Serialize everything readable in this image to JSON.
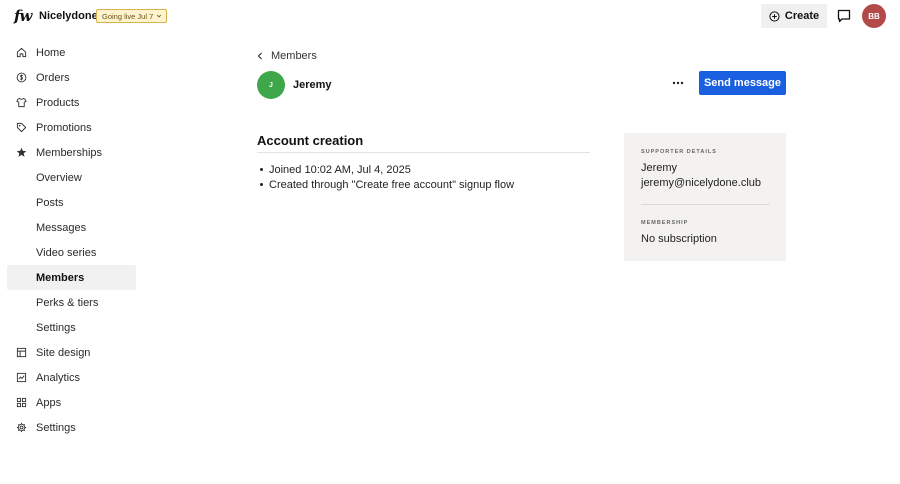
{
  "header": {
    "logo_text": "fw",
    "site_name": "Nicelydone",
    "live_badge": "Going live Jul 7",
    "create_label": "Create",
    "user_initials": "BB"
  },
  "sidebar": {
    "items": [
      {
        "label": "Home",
        "icon": "home-icon"
      },
      {
        "label": "Orders",
        "icon": "orders-icon"
      },
      {
        "label": "Products",
        "icon": "products-icon"
      },
      {
        "label": "Promotions",
        "icon": "tag-icon"
      },
      {
        "label": "Memberships",
        "icon": "star-icon"
      },
      {
        "label": "Overview"
      },
      {
        "label": "Posts"
      },
      {
        "label": "Messages"
      },
      {
        "label": "Video series"
      },
      {
        "label": "Members",
        "active": true
      },
      {
        "label": "Perks & tiers"
      },
      {
        "label": "Settings"
      },
      {
        "label": "Site design",
        "icon": "layout-icon"
      },
      {
        "label": "Analytics",
        "icon": "analytics-icon"
      },
      {
        "label": "Apps",
        "icon": "apps-icon"
      },
      {
        "label": "Settings",
        "icon": "gear-icon"
      }
    ]
  },
  "main": {
    "breadcrumb": "Members",
    "member": {
      "initial": "J",
      "name": "Jeremy"
    },
    "send_message_label": "Send message",
    "section_title": "Account creation",
    "events": [
      "Joined 10:02 AM, Jul 4, 2025",
      "Created through \"Create free account\" signup flow"
    ]
  },
  "details": {
    "supporter_label": "SUPPORTER DETAILS",
    "supporter_name": "Jeremy",
    "supporter_email": "jeremy@nicelydone.club",
    "membership_label": "MEMBERSHIP",
    "membership_value": "No subscription"
  },
  "colors": {
    "primary": "#1a5fe0",
    "member_avatar": "#3fa64a",
    "user_avatar": "#b24a4a",
    "badge_bg": "#fdf3cf",
    "card_bg": "#f3f2f0"
  }
}
